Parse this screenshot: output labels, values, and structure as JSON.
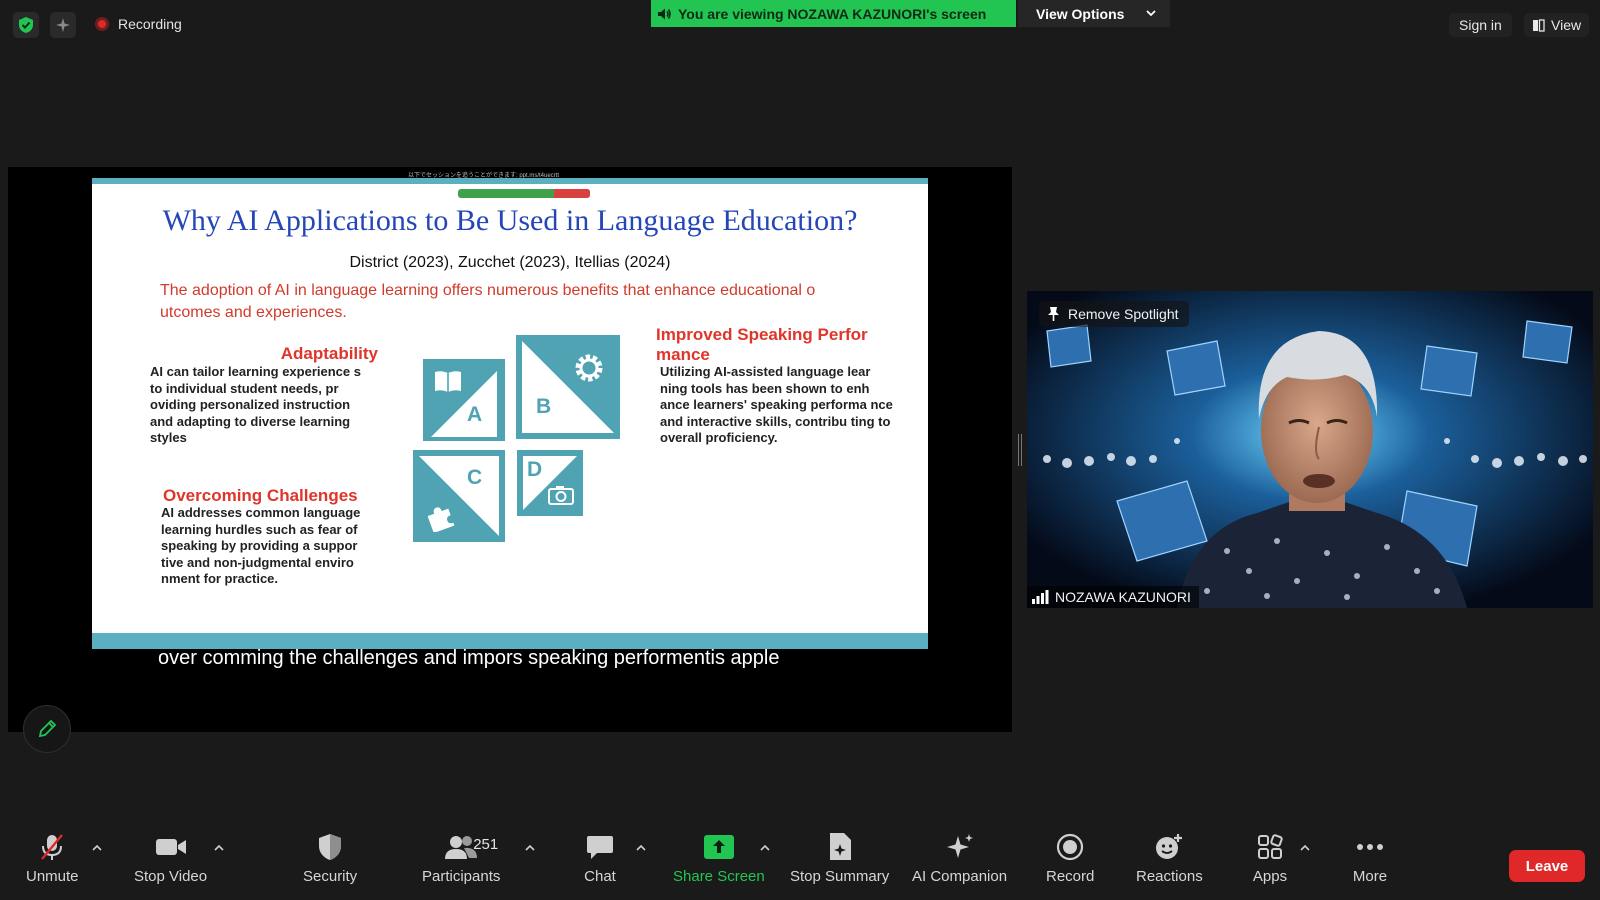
{
  "topbar": {
    "recording_label": "Recording",
    "viewing_banner": "You are viewing NOZAWA KAZUNORI's screen",
    "view_options_label": "View Options",
    "sign_in_label": "Sign in",
    "view_label": "View"
  },
  "share": {
    "header_text": "以下でセッションを追うことができます: ppt.ms/t4uecrtt",
    "slide": {
      "title": "Why AI Applications to Be Used in Language Education?",
      "citation": "District (2023), Zucchet (2023), Itellias (2024)",
      "intro": "The adoption of AI in language learning offers numerous benefits that enhance educational o utcomes and experiences.",
      "sections": [
        {
          "heading": "Adaptability",
          "body": "AI can tailor learning experience s to individual student needs, pr oviding personalized instruction and adapting to diverse learning styles"
        },
        {
          "heading": "Improved Speaking Perfor mance",
          "body": "Utilizing AI-assisted language lear ning tools has been shown to enh ance learners' speaking performa nce and interactive skills, contribu ting to overall proficiency."
        },
        {
          "heading": "Overcoming Challenges",
          "body": "AI addresses common language learning hurdles such as fear of speaking by providing a suppor tive and non-judgmental enviro nment for practice."
        }
      ],
      "tiles": [
        {
          "letter": "A",
          "icon": "book-icon"
        },
        {
          "letter": "B",
          "icon": "gear-icon"
        },
        {
          "letter": "C",
          "icon": "puzzle-icon"
        },
        {
          "letter": "D",
          "icon": "camera-icon"
        }
      ],
      "accent_color": "#4fa3b2"
    },
    "caption": "over comming the challenges and impors speaking performentis apple"
  },
  "video": {
    "spotlight_label": "Remove Spotlight",
    "participant_name": "NOZAWA KAZUNORI"
  },
  "toolbar": {
    "unmute": "Unmute",
    "stop_video": "Stop Video",
    "security": "Security",
    "participants": "Participants",
    "participant_count": "251",
    "chat": "Chat",
    "share_screen": "Share Screen",
    "stop_summary": "Stop Summary",
    "ai_companion": "AI Companion",
    "record": "Record",
    "reactions": "Reactions",
    "apps": "Apps",
    "more": "More",
    "leave": "Leave"
  },
  "colors": {
    "banner_green": "#23c552",
    "leave_red": "#e02828",
    "slide_title_blue": "#2446b8",
    "slide_red": "#e0352a"
  }
}
